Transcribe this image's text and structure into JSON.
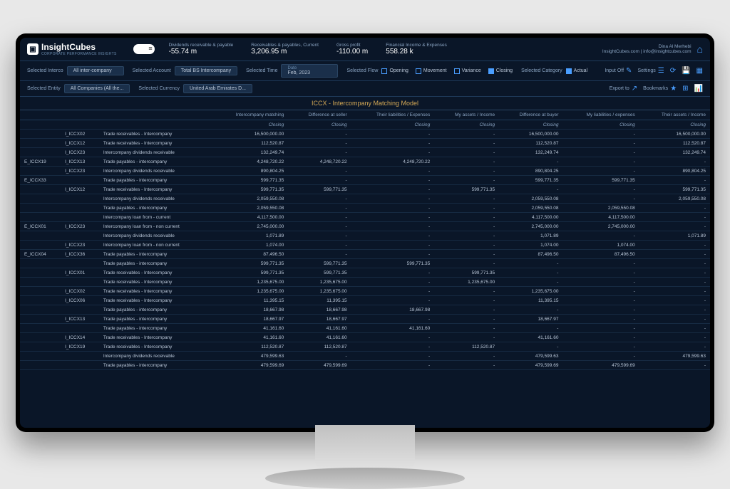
{
  "brand": {
    "name": "InsightCubes",
    "tagline": "CORPORATE PERFORMANCE INSIGHTS"
  },
  "metrics": [
    {
      "label": "Dividends receivable & payable",
      "value": "-55.74 m"
    },
    {
      "label": "Receivables & payables, Current",
      "value": "3,206.95 m"
    },
    {
      "label": "Gross profit",
      "value": "-110.00 m"
    },
    {
      "label": "Financial Income & Expenses",
      "value": "558.28 k"
    }
  ],
  "user": {
    "name": "Dina Al Merhebi",
    "contact": "InsightCubes.com | info@insightcubes.com"
  },
  "filters": {
    "interco": {
      "label": "Selected Interco",
      "value": "All inter-company"
    },
    "account": {
      "label": "Selected Account",
      "value": "Total BS Intercompany"
    },
    "entity": {
      "label": "Selected Entity",
      "value": "All Companies (All the..."
    },
    "currency": {
      "label": "Selected Currency",
      "value": "United Arab Emirates D..."
    },
    "time": {
      "label": "Selected Time",
      "sub": "Date",
      "value": "Feb, 2023"
    },
    "flow": {
      "label": "Selected Flow",
      "options": [
        {
          "name": "Opening",
          "on": false
        },
        {
          "name": "Movement",
          "on": false
        },
        {
          "name": "Variance",
          "on": false
        },
        {
          "name": "Closing",
          "on": true
        }
      ]
    },
    "category": {
      "label": "Selected Category",
      "options": [
        {
          "name": "Actual",
          "on": true
        }
      ]
    }
  },
  "actions": {
    "input": "Input Off",
    "settings": "Settings",
    "export": "Export to",
    "bookmarks": "Bookmarks"
  },
  "title": "ICCX - Intercompany Matching Model",
  "columns": [
    "",
    "",
    "",
    "Intercompany matching",
    "Difference at seller",
    "Their liabilities / Expenses",
    "My assets / Income",
    "Difference at buyer",
    "My liabilities / expenses",
    "Their assets / Income"
  ],
  "subheader": "Closing",
  "rows": [
    {
      "c1": "",
      "c2": "I_ICCX02",
      "c3": "Trade receivables - Intercompany",
      "v": [
        "16,500,000.00",
        "-",
        "-",
        "-",
        "16,500,000.00",
        "-",
        "16,500,000.00"
      ]
    },
    {
      "c1": "",
      "c2": "I_ICCX12",
      "c3": "Trade receivables - Intercompany",
      "v": [
        "112,520.87",
        "-",
        "-",
        "-",
        "112,520.87",
        "-",
        "112,520.87"
      ]
    },
    {
      "c1": "",
      "c2": "I_ICCX23",
      "c3": "Intercompany dividends receivable",
      "v": [
        "132,249.74",
        "-",
        "-",
        "-",
        "132,249.74",
        "-",
        "132,249.74"
      ]
    },
    {
      "c1": "E_ICCX19",
      "c2": "I_ICCX13",
      "c3": "Trade payables - intercompany",
      "v": [
        "4,248,720.22",
        "4,248,720.22",
        "4,248,720.22",
        "-",
        "-",
        "-",
        "-"
      ]
    },
    {
      "c1": "",
      "c2": "I_ICCX23",
      "c3": "Intercompany dividends receivable",
      "v": [
        "890,804.25",
        "-",
        "-",
        "-",
        "890,804.25",
        "-",
        "890,804.25"
      ]
    },
    {
      "c1": "E_ICCX33",
      "c2": "",
      "c3": "Trade payables - intercompany",
      "v": [
        "599,771.35",
        "-",
        "-",
        "-",
        "599,771.35",
        "599,771.35",
        "-"
      ]
    },
    {
      "c1": "",
      "c2": "I_ICCX12",
      "c3": "Trade receivables - Intercompany",
      "v": [
        "599,771.35",
        "599,771.35",
        "-",
        "599,771.35",
        "-",
        "-",
        "599,771.35"
      ]
    },
    {
      "c1": "",
      "c2": "",
      "c3": "Intercompany dividends receivable",
      "v": [
        "2,059,550.08",
        "-",
        "-",
        "-",
        "2,059,550.08",
        "-",
        "2,059,550.08"
      ]
    },
    {
      "c1": "",
      "c2": "",
      "c3": "Trade payables - intercompany",
      "v": [
        "2,059,550.08",
        "-",
        "-",
        "-",
        "2,059,550.08",
        "2,059,550.08",
        "-"
      ]
    },
    {
      "c1": "",
      "c2": "",
      "c3": "Intercompany loan from - current",
      "v": [
        "4,117,500.00",
        "-",
        "-",
        "-",
        "4,117,500.00",
        "4,117,500.00",
        "-"
      ]
    },
    {
      "c1": "E_ICCX01",
      "c2": "I_ICCX23",
      "c3": "Intercompany loan from - non current",
      "v": [
        "2,745,000.00",
        "-",
        "-",
        "-",
        "2,745,000.00",
        "2,745,000.00",
        "-"
      ]
    },
    {
      "c1": "",
      "c2": "",
      "c3": "Intercompany dividends receivable",
      "v": [
        "1,071.89",
        "-",
        "-",
        "-",
        "1,071.89",
        "-",
        "1,071.89"
      ]
    },
    {
      "c1": "",
      "c2": "I_ICCX23",
      "c3": "Intercompany loan from - non current",
      "v": [
        "1,074.00",
        "-",
        "-",
        "-",
        "1,074.00",
        "1,074.00",
        "-"
      ]
    },
    {
      "c1": "E_ICCX04",
      "c2": "I_ICCX36",
      "c3": "Trade payables - intercompany",
      "v": [
        "87,496.50",
        "-",
        "-",
        "-",
        "87,496.50",
        "87,496.50",
        "-"
      ]
    },
    {
      "c1": "",
      "c2": "",
      "c3": "Trade payables - intercompany",
      "v": [
        "599,771.35",
        "599,771.35",
        "599,771.35",
        "-",
        "-",
        "-",
        "-"
      ]
    },
    {
      "c1": "",
      "c2": "I_ICCX01",
      "c3": "Trade receivables - Intercompany",
      "v": [
        "599,771.35",
        "599,771.35",
        "-",
        "599,771.35",
        "-",
        "-",
        "-"
      ]
    },
    {
      "c1": "",
      "c2": "",
      "c3": "Trade receivables - Intercompany",
      "v": [
        "1,235,675.00",
        "1,235,675.00",
        "-",
        "1,235,675.00",
        "-",
        "-",
        "-"
      ]
    },
    {
      "c1": "",
      "c2": "I_ICCX02",
      "c3": "Trade receivables - Intercompany",
      "v": [
        "1,235,675.00",
        "1,235,675.00",
        "-",
        "-",
        "1,235,675.00",
        "-",
        "-"
      ]
    },
    {
      "c1": "",
      "c2": "I_ICCX06",
      "c3": "Trade receivables - Intercompany",
      "v": [
        "11,395.15",
        "11,395.15",
        "-",
        "-",
        "11,395.15",
        "-",
        "-"
      ]
    },
    {
      "c1": "",
      "c2": "",
      "c3": "Trade payables - intercompany",
      "v": [
        "18,667.98",
        "18,667.98",
        "18,667.98",
        "-",
        "-",
        "-",
        "-"
      ]
    },
    {
      "c1": "",
      "c2": "I_ICCX13",
      "c3": "Trade payables - intercompany",
      "v": [
        "18,667.97",
        "18,667.97",
        "-",
        "-",
        "18,667.97",
        "-",
        "-"
      ]
    },
    {
      "c1": "",
      "c2": "",
      "c3": "Trade payables - intercompany",
      "v": [
        "41,161.60",
        "41,161.60",
        "41,161.60",
        "-",
        "-",
        "-",
        "-"
      ]
    },
    {
      "c1": "",
      "c2": "I_ICCX14",
      "c3": "Trade receivables - Intercompany",
      "v": [
        "41,161.60",
        "41,161.60",
        "-",
        "-",
        "41,161.60",
        "-",
        "-"
      ]
    },
    {
      "c1": "",
      "c2": "I_ICCX19",
      "c3": "Trade receivables - Intercompany",
      "v": [
        "112,520.87",
        "112,520.87",
        "-",
        "112,520.87",
        "-",
        "-",
        "-"
      ]
    },
    {
      "c1": "",
      "c2": "",
      "c3": "Intercompany dividends receivable",
      "v": [
        "479,599.63",
        "-",
        "-",
        "-",
        "479,599.63",
        "-",
        "479,599.63"
      ]
    },
    {
      "c1": "",
      "c2": "",
      "c3": "Trade payables - intercompany",
      "v": [
        "479,599.69",
        "479,599.69",
        "-",
        "-",
        "479,599.69",
        "479,599.69",
        "-"
      ]
    }
  ]
}
